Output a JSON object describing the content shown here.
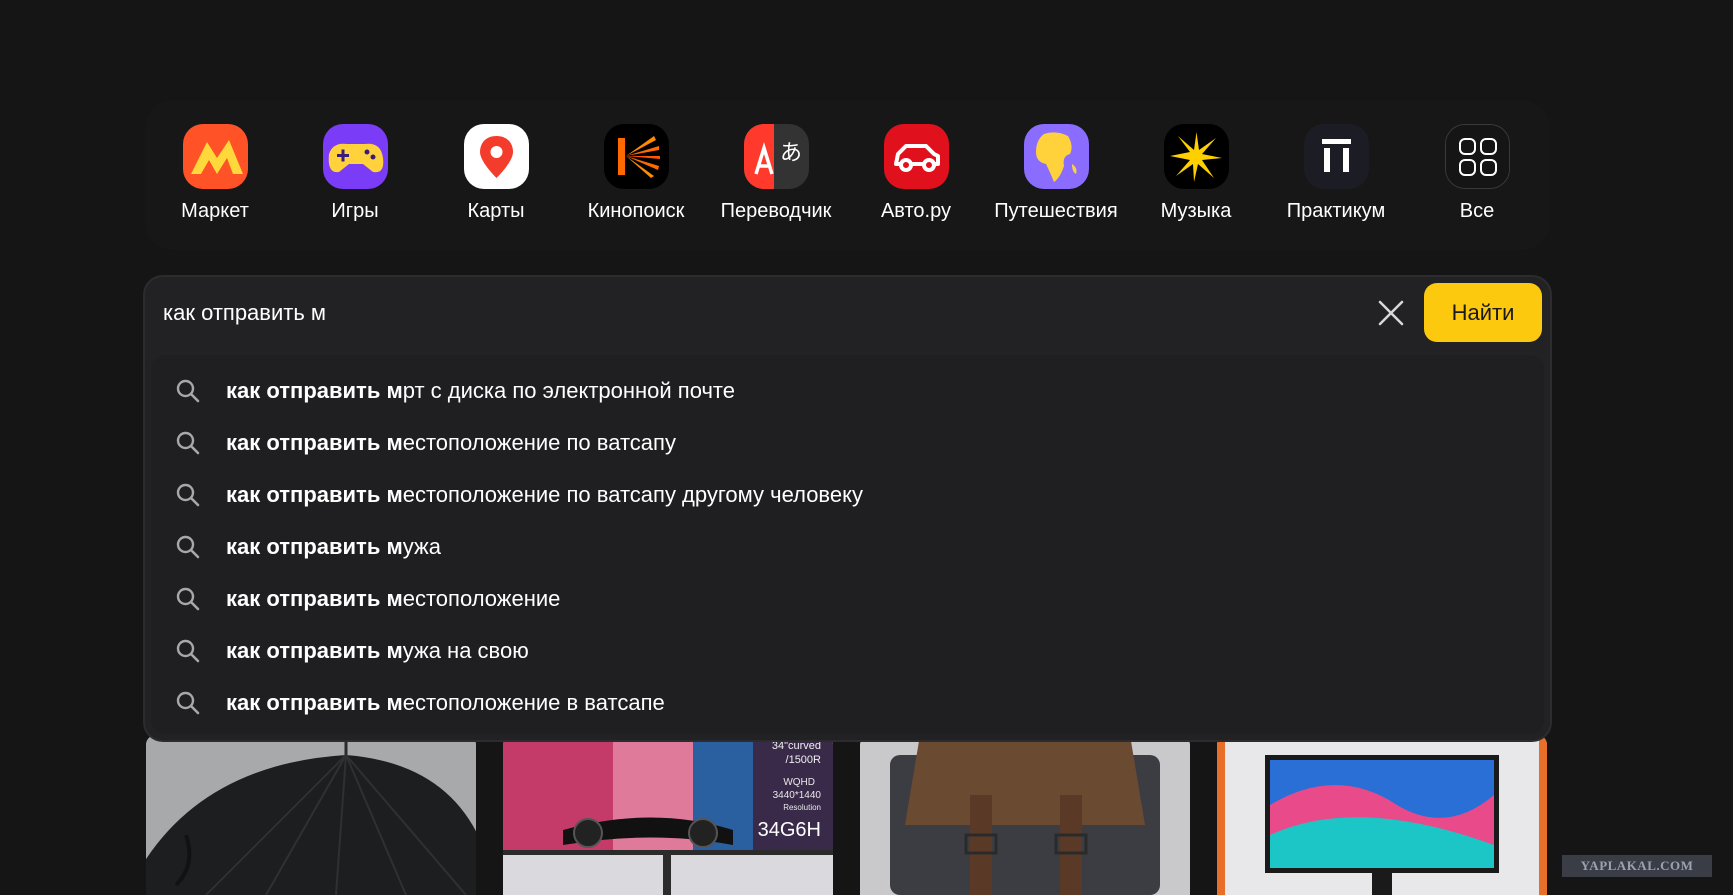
{
  "services": [
    {
      "label": "Маркет",
      "icon": "market-icon"
    },
    {
      "label": "Игры",
      "icon": "games-icon"
    },
    {
      "label": "Карты",
      "icon": "maps-icon"
    },
    {
      "label": "Кинопоиск",
      "icon": "kinopoisk-icon"
    },
    {
      "label": "Переводчик",
      "icon": "translator-icon"
    },
    {
      "label": "Авто.ру",
      "icon": "autoru-icon"
    },
    {
      "label": "Путешествия",
      "icon": "travel-icon"
    },
    {
      "label": "Музыка",
      "icon": "music-icon"
    },
    {
      "label": "Практикум",
      "icon": "practicum-icon"
    },
    {
      "label": "Все",
      "icon": "all-services-icon"
    }
  ],
  "search": {
    "value": "как отправить м",
    "button_label": "Найти"
  },
  "suggestions": [
    {
      "prefix": "как отправить м",
      "rest": "рт с диска по электронной почте"
    },
    {
      "prefix": "как отправить м",
      "rest": "естоположение по ватсапу"
    },
    {
      "prefix": "как отправить м",
      "rest": "естоположение по ватсапу другому человеку"
    },
    {
      "prefix": "как отправить м",
      "rest": "ужа"
    },
    {
      "prefix": "как отправить м",
      "rest": "естоположение"
    },
    {
      "prefix": "как отправить м",
      "rest": "ужа на свою"
    },
    {
      "prefix": "как отправить м",
      "rest": "естоположение в ватсапе"
    }
  ],
  "feed_cards": [
    {
      "icon": "umbrella-image",
      "caption": ""
    },
    {
      "icon": "curved-monitor-image",
      "spec_lines": [
        "34\"curved",
        "/1500R",
        "WQHD",
        "3440*1440",
        "Resolution"
      ],
      "model": "34G6H"
    },
    {
      "icon": "leather-bag-image",
      "caption": ""
    },
    {
      "icon": "monitor-image",
      "caption": ""
    }
  ],
  "watermark": "YAPLAKAL.COM",
  "colors": {
    "background": "#151515",
    "search_panel": "#222224",
    "find_button": "#fcc90e",
    "text": "#ffffff"
  }
}
